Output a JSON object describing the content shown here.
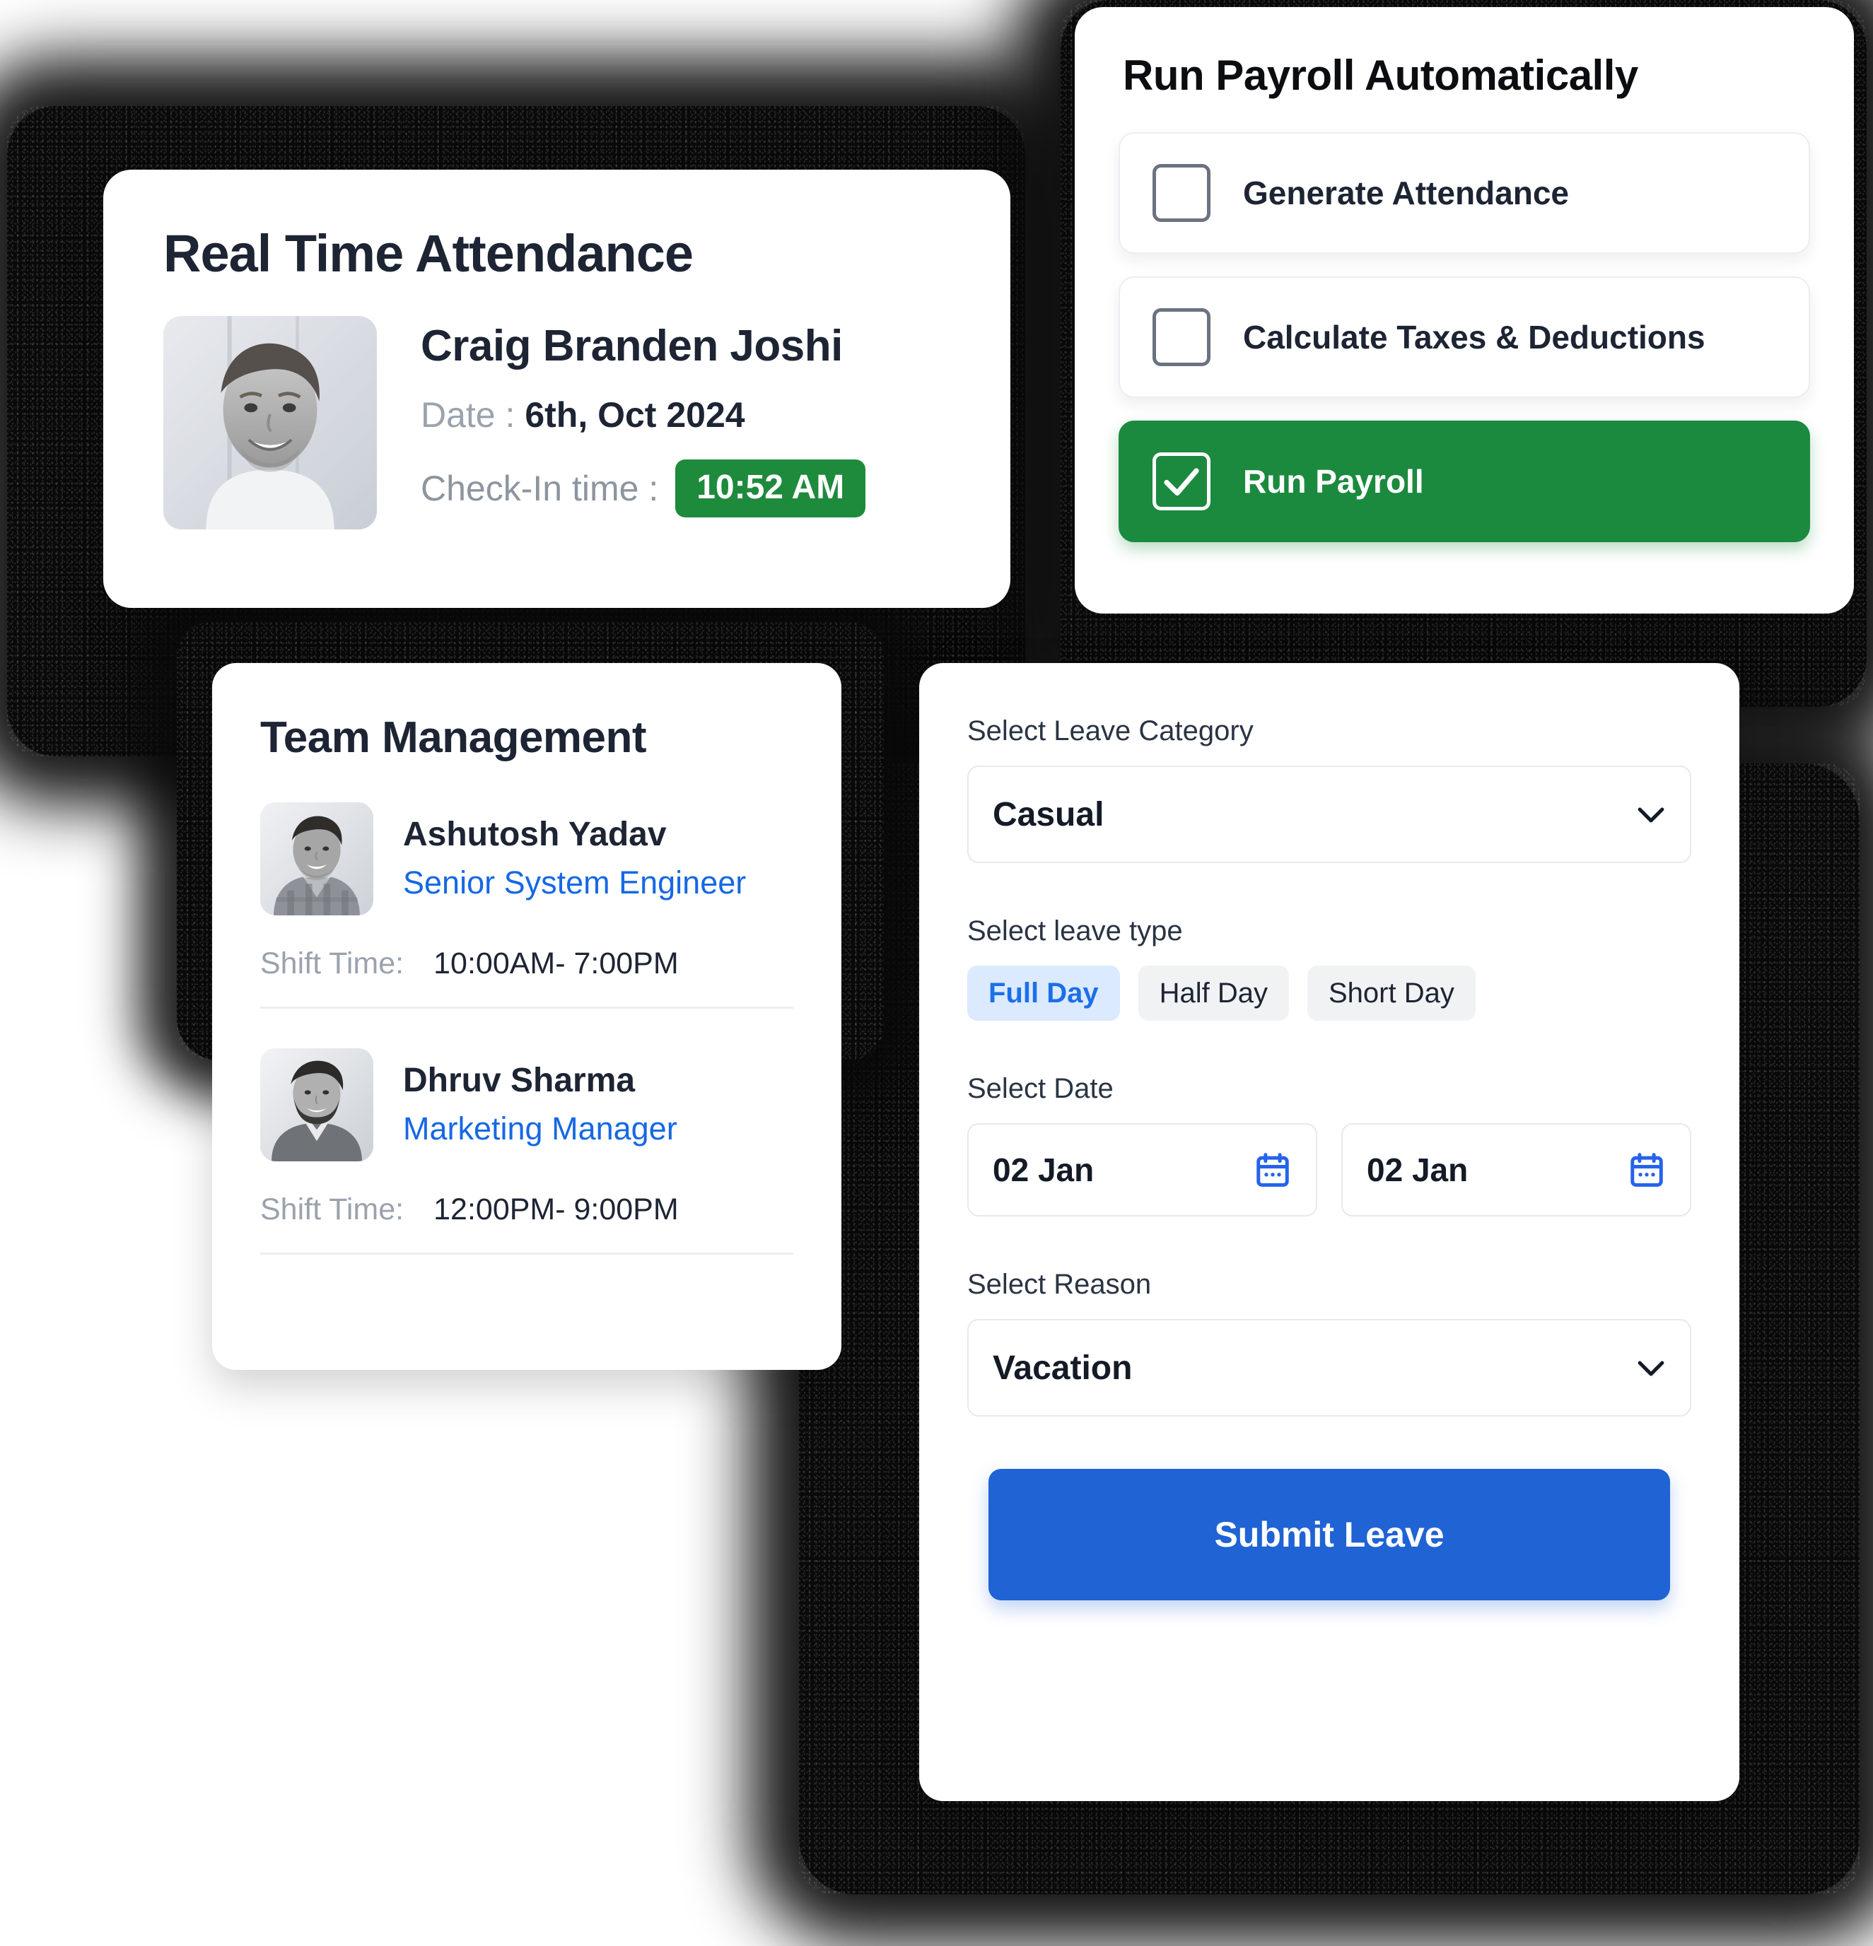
{
  "attendance": {
    "title": "Real Time Attendance",
    "employee_name": "Craig Branden Joshi",
    "date_label": "Date :",
    "date_value": "6th, Oct 2024",
    "checkin_label": "Check-In time :",
    "checkin_time": "10:52 AM",
    "badge_color": "#1e8a3c",
    "avatar_name": "craig-branden-joshi-avatar"
  },
  "payroll": {
    "title": "Run Payroll Automatically",
    "items": [
      {
        "label": "Generate Attendance",
        "checked": false
      },
      {
        "label": "Calculate Taxes & Deductions",
        "checked": false
      },
      {
        "label": "Run Payroll",
        "checked": true
      }
    ],
    "active_color": "#1b8a3e"
  },
  "team": {
    "title": "Team Management",
    "shift_label": "Shift Time:",
    "members": [
      {
        "name": "Ashutosh Yadav",
        "role": "Senior System Engineer",
        "shift": "10:00AM- 7:00PM"
      },
      {
        "name": "Dhruv Sharma",
        "role": "Marketing Manager",
        "shift": "12:00PM- 9:00PM"
      }
    ],
    "role_color": "#1668e3"
  },
  "leave": {
    "category_label": "Select Leave Category",
    "category_value": "Casual",
    "type_label": "Select leave type",
    "types": [
      {
        "label": "Full Day",
        "selected": true
      },
      {
        "label": "Half Day",
        "selected": false
      },
      {
        "label": "Short Day",
        "selected": false
      }
    ],
    "date_label": "Select Date",
    "date_from": "02 Jan",
    "date_to": "02 Jan",
    "reason_label": "Select Reason",
    "reason_value": "Vacation",
    "submit_label": "Submit Leave",
    "accent_color": "#1f63d4",
    "selected_pill_bg": "#dbeafe",
    "selected_pill_text": "#1d6fe8"
  }
}
